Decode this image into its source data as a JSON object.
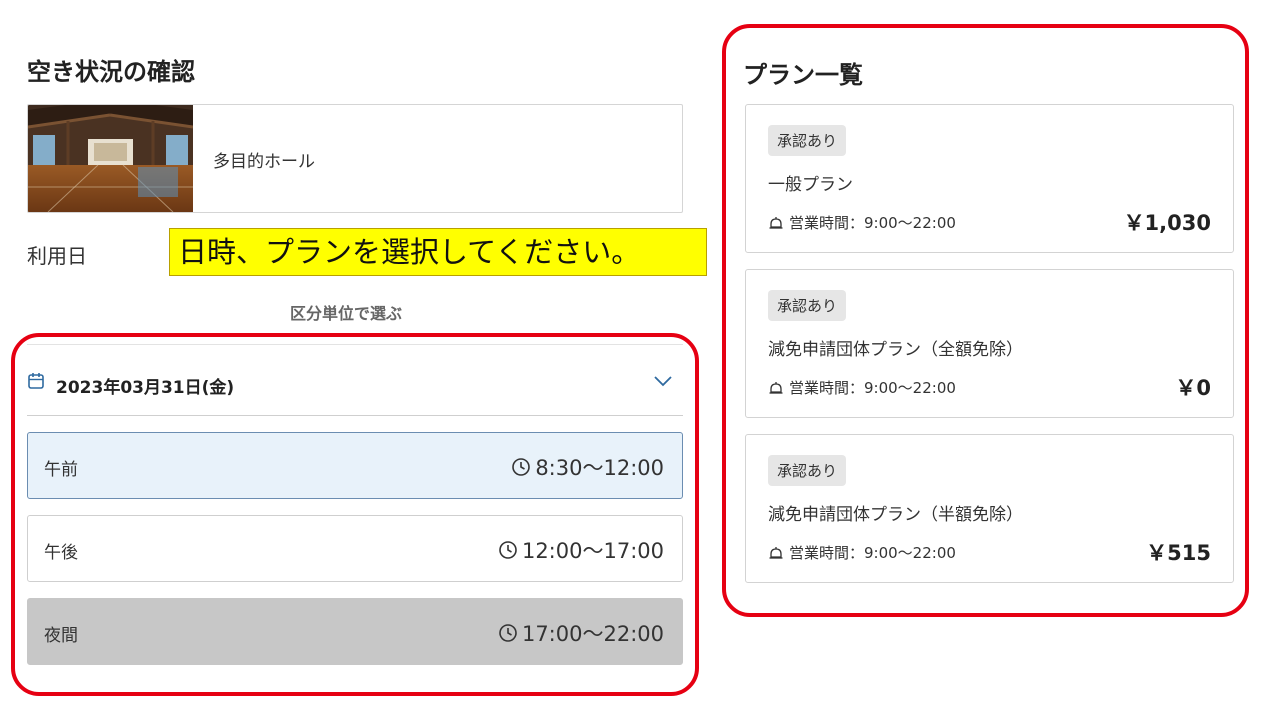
{
  "page": {
    "heading": "空き状況の確認",
    "usage_date_label": "利用日",
    "instruction_callout": "日時、プランを選択してください。",
    "mode_link": "区分単位で選ぶ"
  },
  "facility": {
    "name": "多目的ホール"
  },
  "date_selector": {
    "date": "2023年03月31日(金)"
  },
  "time_slots": [
    {
      "name": "午前",
      "time": "8:30～12:00",
      "state": "selected"
    },
    {
      "name": "午後",
      "time": "12:00～17:00",
      "state": "available"
    },
    {
      "name": "夜間",
      "time": "17:00～22:00",
      "state": "unavailable"
    }
  ],
  "plans_section": {
    "heading": "プラン一覧",
    "items": [
      {
        "badge": "承認あり",
        "name": "一般プラン",
        "hours": "営業時間：9:00～22:00",
        "price": "￥1,030"
      },
      {
        "badge": "承認あり",
        "name": "減免申請団体プラン（全額免除）",
        "hours": "営業時間：9:00～22:00",
        "price": "￥0"
      },
      {
        "badge": "承認あり",
        "name": "減免申請団体プラン（半額免除）",
        "hours": "営業時間：9:00～22:00",
        "price": "￥515"
      }
    ]
  },
  "colors": {
    "emphasis_frame": "#e60012",
    "callout_background": "#ffff00",
    "selected_slot_background": "#e8f2fa",
    "selected_slot_border": "#6b8db1",
    "unavailable_slot_background": "#c7c7c7"
  },
  "icons": {
    "calendar": "calendar-icon",
    "chevron": "chevron-down-icon",
    "clock": "clock-icon",
    "hours": "bell-icon"
  }
}
